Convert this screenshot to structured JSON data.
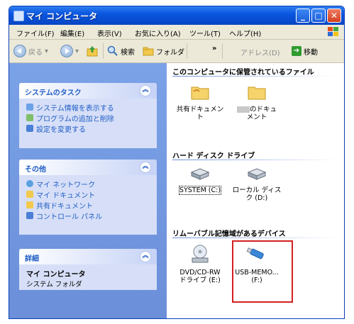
{
  "window": {
    "title": "マイ コンピュータ"
  },
  "menubar": {
    "items": [
      "ファイル(F)",
      "編集(E)",
      "表示(V)",
      "お気に入り(A)",
      "ツール(T)",
      "ヘルプ(H)"
    ]
  },
  "toolbar": {
    "back_label": "戻る",
    "search_label": "検索",
    "folders_label": "フォルダ",
    "chevron": "»",
    "address_label": "アドレス(D)",
    "go_label": "移動"
  },
  "sidebar": {
    "system_tasks": {
      "title": "システムのタスク",
      "items": [
        "システム情報を表示する",
        "プログラムの追加と削除",
        "設定を変更する"
      ]
    },
    "other_places": {
      "title": "その他",
      "items": [
        "マイ ネットワーク",
        "マイ ドキュメント",
        "共有ドキュメント",
        "コントロール パネル"
      ]
    },
    "details": {
      "title": "詳細",
      "name": "マイ コンピュータ",
      "type": "システム フォルダ"
    }
  },
  "content": {
    "groups": [
      {
        "title": "このコンピュータに保管されているファイル"
      },
      {
        "title": "ハード ディスク ドライブ"
      },
      {
        "title": "リムーバブル記憶域があるデバイス"
      }
    ],
    "files": [
      {
        "label_line1": "共有ドキュメン",
        "label_line2": "ト"
      },
      {
        "label_line1": "のドキュ",
        "label_line2": "メント"
      }
    ],
    "drives": [
      {
        "label_line1": "SYSTEM (C:)",
        "label_line2": ""
      },
      {
        "label_line1": "ローカル ディス",
        "label_line2": "ク (D:)"
      }
    ],
    "removable": [
      {
        "label_line1": "DVD/CD-RW",
        "label_line2": "ドライブ (E:)"
      },
      {
        "label_line1": "USB-MEMO...",
        "label_line2": "(F:)"
      }
    ]
  },
  "colors": {
    "titlebar": "#0a56e0",
    "sidebar": "#6b8fd9",
    "task_link": "#215dc6",
    "highlight": "#d22020"
  }
}
